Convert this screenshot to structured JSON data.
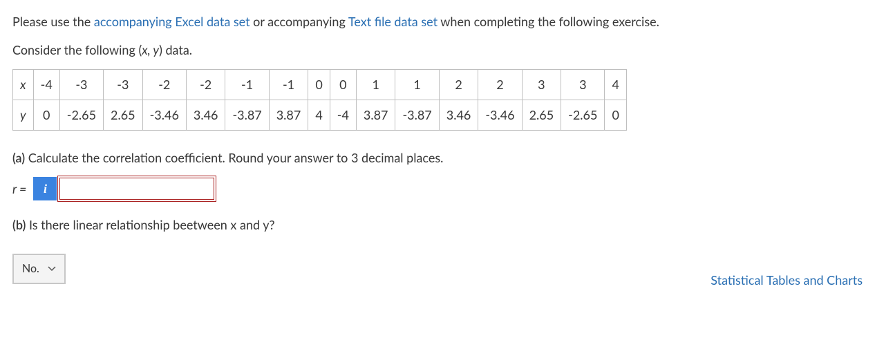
{
  "intro": {
    "prefix": "Please use the ",
    "link1": "accompanying Excel data set",
    "mid": " or accompanying ",
    "link2": "Text file data set",
    "suffix": " when completing the following exercise."
  },
  "consider": {
    "prefix": "Consider the following (",
    "xy": "x, y",
    "suffix": ") data."
  },
  "table": {
    "x_label": "x",
    "y_label": "y",
    "x": [
      "-4",
      "-3",
      "-3",
      "-2",
      "-2",
      "-1",
      "-1",
      "0",
      "0",
      "1",
      "1",
      "2",
      "2",
      "3",
      "3",
      "4"
    ],
    "y": [
      "0",
      "-2.65",
      "2.65",
      "-3.46",
      "3.46",
      "-3.87",
      "3.87",
      "4",
      "-4",
      "3.87",
      "-3.87",
      "3.46",
      "-3.46",
      "2.65",
      "-2.65",
      "0"
    ]
  },
  "partA": {
    "label": "(a)",
    "text": " Calculate the correlation coefficient. Round your answer to 3 decimal places.",
    "r_equals": "r = ",
    "info_icon": "i",
    "input_value": ""
  },
  "partB": {
    "label": "(b)",
    "text": " Is there linear relationship beetween x and y?",
    "selected": "No."
  },
  "footer_link": "Statistical Tables and Charts"
}
